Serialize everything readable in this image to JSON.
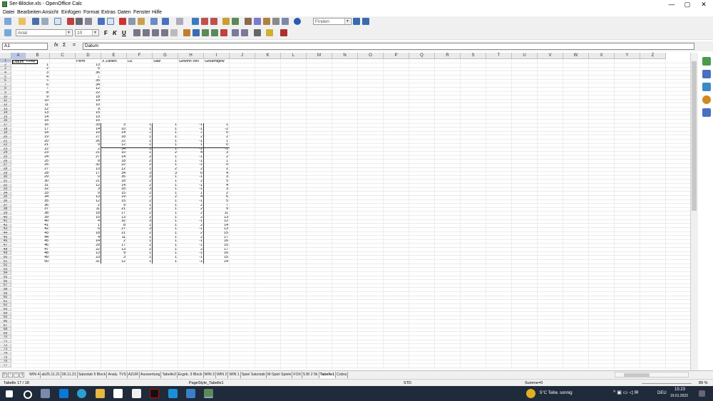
{
  "window": {
    "title": "Ser-Blöcke.xls - OpenOffice Calc",
    "min_label": "—",
    "max_label": "▢",
    "close_label": "✕"
  },
  "menu": [
    "Datei",
    "Bearbeiten",
    "Ansicht",
    "Einfügen",
    "Format",
    "Extras",
    "Daten",
    "Fenster",
    "Hilfe"
  ],
  "toolbar": {
    "find_placeholder": "Finden",
    "font_name": "Arial",
    "font_size": "10",
    "bold": "F",
    "italic": "K",
    "underline": "U"
  },
  "formula": {
    "cell_ref": "A1",
    "fx": "fx",
    "sum": "Σ",
    "equals": "=",
    "content": "Datum"
  },
  "columns": [
    "A",
    "B",
    "C",
    "D",
    "E",
    "F",
    "G",
    "H",
    "I",
    "J",
    "K",
    "L",
    "M",
    "N",
    "O",
    "P",
    "Q",
    "R",
    "S",
    "T",
    "U",
    "V",
    "W",
    "X",
    "Y",
    "Z"
  ],
  "headers": [
    "Datum",
    "Coup",
    "",
    "Perm",
    "X Zahlen",
    "DZ",
    "Satz",
    "Gewinn Verl",
    "Gesamtgew"
  ],
  "data_rows": [
    {
      "coup": "1",
      "perm": "13",
      "x": "",
      "dz": "",
      "satz": "",
      "gv": "",
      "ges": ""
    },
    {
      "coup": "2",
      "perm": "5",
      "x": "",
      "dz": "",
      "satz": "",
      "gv": "",
      "ges": ""
    },
    {
      "coup": "3",
      "perm": "36",
      "x": "",
      "dz": "",
      "satz": "",
      "gv": "",
      "ges": ""
    },
    {
      "coup": "4",
      "perm": "1",
      "x": "",
      "dz": "",
      "satz": "",
      "gv": "",
      "ges": ""
    },
    {
      "coup": "5",
      "perm": "35",
      "x": "",
      "dz": "",
      "satz": "",
      "gv": "",
      "ges": ""
    },
    {
      "coup": "6",
      "perm": "34",
      "x": "",
      "dz": "",
      "satz": "",
      "gv": "",
      "ges": ""
    },
    {
      "coup": "7",
      "perm": "12",
      "x": "",
      "dz": "",
      "satz": "",
      "gv": "",
      "ges": ""
    },
    {
      "coup": "8",
      "perm": "22",
      "x": "",
      "dz": "",
      "satz": "",
      "gv": "",
      "ges": ""
    },
    {
      "coup": "9",
      "perm": "18",
      "x": "",
      "dz": "",
      "satz": "",
      "gv": "",
      "ges": ""
    },
    {
      "coup": "10",
      "perm": "14",
      "x": "",
      "dz": "",
      "satz": "",
      "gv": "",
      "ges": ""
    },
    {
      "coup": "11",
      "perm": "10",
      "x": "",
      "dz": "",
      "satz": "",
      "gv": "",
      "ges": ""
    },
    {
      "coup": "12",
      "perm": "9",
      "x": "",
      "dz": "",
      "satz": "",
      "gv": "",
      "ges": ""
    },
    {
      "coup": "13",
      "perm": "15",
      "x": "",
      "dz": "",
      "satz": "",
      "gv": "",
      "ges": ""
    },
    {
      "coup": "14",
      "perm": "19",
      "x": "",
      "dz": "",
      "satz": "",
      "gv": "",
      "ges": ""
    },
    {
      "coup": "15",
      "perm": "15",
      "x": "",
      "dz": "",
      "satz": "",
      "gv": "",
      "ges": ""
    },
    {
      "coup": "16",
      "perm": "33",
      "x": "3",
      "dz": "1",
      "satz": "1",
      "gv": "-1",
      "ges": "1"
    },
    {
      "coup": "17",
      "perm": "14",
      "x": "10",
      "dz": "1",
      "satz": "1",
      "gv": "-1",
      "ges": "-2"
    },
    {
      "coup": "18",
      "perm": "10",
      "x": "14",
      "dz": "2",
      "satz": "1",
      "gv": "2",
      "ges": "0"
    },
    {
      "coup": "19",
      "perm": "27",
      "x": "18",
      "dz": "1",
      "satz": "1",
      "gv": "2",
      "ges": "2"
    },
    {
      "coup": "20",
      "perm": "26",
      "x": "22",
      "dz": "1",
      "satz": "1",
      "gv": "-1",
      "ges": "1"
    },
    {
      "coup": "21",
      "perm": "9",
      "x": "12",
      "dz": "1",
      "satz": "1",
      "gv": "1",
      "ges": "0"
    },
    {
      "coup": "22",
      "perm": "2",
      "x": "34",
      "dz": "3",
      "satz": "1",
      "gv": "-1",
      "ges": "-1"
    },
    {
      "coup": "23",
      "perm": "21",
      "x": "10",
      "dz": "1",
      "satz": "2",
      "gv": "4",
      "ges": "3"
    },
    {
      "coup": "24",
      "perm": "27",
      "x": "14",
      "dz": "2",
      "satz": "1",
      "gv": "-1",
      "ges": "2"
    },
    {
      "coup": "25",
      "perm": "8",
      "x": "18",
      "dz": "2",
      "satz": "1",
      "gv": "-1",
      "ges": "1"
    },
    {
      "coup": "26",
      "perm": "32",
      "x": "22",
      "dz": "2",
      "satz": "1",
      "gv": "-1",
      "ges": "0"
    },
    {
      "coup": "27",
      "perm": "13",
      "x": "12",
      "dz": "1",
      "satz": "2",
      "gv": "2",
      "ges": "2"
    },
    {
      "coup": "28",
      "perm": "17",
      "x": "34",
      "dz": "3",
      "satz": "3",
      "gv": "6",
      "ges": "4"
    },
    {
      "coup": "29",
      "perm": "0",
      "x": "35",
      "dz": "3",
      "satz": "1",
      "gv": "-1",
      "ges": "3"
    },
    {
      "coup": "30",
      "perm": "21",
      "x": "18",
      "dz": "2",
      "satz": "1",
      "gv": "2",
      "ges": "5"
    },
    {
      "coup": "31",
      "perm": "12",
      "x": "14",
      "dz": "2",
      "satz": "1",
      "gv": "-1",
      "ges": "4"
    },
    {
      "coup": "32",
      "perm": "3",
      "x": "33",
      "dz": "3",
      "satz": "1",
      "gv": "-1",
      "ges": "3"
    },
    {
      "coup": "33",
      "perm": "9",
      "x": "15",
      "dz": "2",
      "satz": "1",
      "gv": "1",
      "ges": "2"
    },
    {
      "coup": "34",
      "perm": "13",
      "x": "19",
      "dz": "2",
      "satz": "2",
      "gv": "4",
      "ges": "6"
    },
    {
      "coup": "35",
      "perm": "12",
      "x": "15",
      "dz": "2",
      "satz": "1",
      "gv": "-1",
      "ges": "5"
    },
    {
      "coup": "36",
      "perm": "2",
      "x": "9",
      "dz": "1",
      "satz": "1",
      "gv": "2",
      "ges": "7"
    },
    {
      "coup": "37",
      "perm": "11",
      "x": "21",
      "dz": "2",
      "satz": "1",
      "gv": "2",
      "ges": "9"
    },
    {
      "coup": "38",
      "perm": "18",
      "x": "17",
      "dz": "2",
      "satz": "1",
      "gv": "2",
      "ges": "11"
    },
    {
      "coup": "39",
      "perm": "15",
      "x": "13",
      "dz": "2",
      "satz": "1",
      "gv": "2",
      "ges": "13"
    },
    {
      "coup": "40",
      "perm": "4",
      "x": "32",
      "dz": "3",
      "satz": "1",
      "gv": "-1",
      "ges": "12"
    },
    {
      "coup": "41",
      "perm": "1",
      "x": "8",
      "dz": "1",
      "satz": "1",
      "gv": "2",
      "ges": "14"
    },
    {
      "coup": "42",
      "perm": "6",
      "x": "27",
      "dz": "3",
      "satz": "1",
      "gv": "-1",
      "ges": "13"
    },
    {
      "coup": "43",
      "perm": "18",
      "x": "21",
      "dz": "2",
      "satz": "1",
      "gv": "2",
      "ges": "15"
    },
    {
      "coup": "44",
      "perm": "4",
      "x": "11",
      "dz": "1",
      "satz": "1",
      "gv": "2",
      "ges": "17"
    },
    {
      "coup": "45",
      "perm": "14",
      "x": "2",
      "dz": "1",
      "satz": "1",
      "gv": "-1",
      "ges": "16"
    },
    {
      "coup": "46",
      "perm": "29",
      "x": "17",
      "dz": "2",
      "satz": "1",
      "gv": "-1",
      "ges": "15"
    },
    {
      "coup": "47",
      "perm": "22",
      "x": "13",
      "dz": "2",
      "satz": "1",
      "gv": "2",
      "ges": "17"
    },
    {
      "coup": "48",
      "perm": "13",
      "x": "9",
      "dz": "1",
      "satz": "1",
      "gv": "-1",
      "ges": "16"
    },
    {
      "coup": "49",
      "perm": "23",
      "x": "3",
      "dz": "1",
      "satz": "1",
      "gv": "-1",
      "ges": "15"
    },
    {
      "coup": "50",
      "perm": "31",
      "x": "12",
      "dz": "1",
      "satz": "1",
      "gv": "-1",
      "ges": "14"
    }
  ],
  "sheet_tabs": [
    "WIN 4",
    "ab25.11.21",
    "06.11.21",
    "Satzstab 5 Block",
    "Analy. TVS",
    "AZUR",
    "Auswertung",
    "Tabelle3",
    "Ergeb. 3 Block",
    "WIN 3",
    "WIN 2",
    "WIN 1",
    "Spiel Satzstab",
    "M-Spiel Spiele",
    "FOX",
    "5.BI 2 5k",
    "Tabelle1",
    "Cobra"
  ],
  "active_tab": "Tabelle1",
  "status": {
    "sheet": "Tabelle 17 / 18",
    "pagestyle": "PageStyle_Tabelle1",
    "mode": "STD",
    "sum": "Summe=0",
    "zoom": "89 %"
  },
  "taskbar": {
    "weather": "5°C  Teilw. sonnig",
    "lang": "DEU",
    "time": "15:23",
    "date": "19.01.2022"
  },
  "colors": {
    "taskbar_bg": "#1f2a3a",
    "blue_text": "#1a4fd0"
  }
}
